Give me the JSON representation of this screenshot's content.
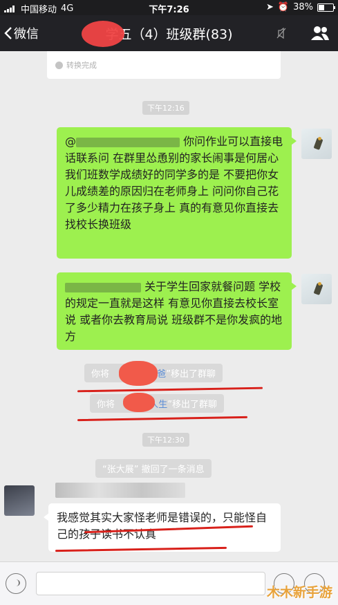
{
  "status_bar": {
    "carrier": "中国移动",
    "network": "4G",
    "time": "下午7:26",
    "battery": "38%",
    "battery_level": 0.38
  },
  "nav": {
    "back_label": "微信",
    "title": "学五（4）班级群(83)"
  },
  "file_card": {
    "status": "转换完成"
  },
  "messages": {
    "time1": "下午12:16",
    "msg1": {
      "mention": "@",
      "text": "你问作业可以直接电话联系问  在群里怂恿别的家长闹事是何居心  我们班数学成绩好的同学多的是  不要把你女儿成绩差的原因归在老师身上  问问你自己花了多少精力在孩子身上  真的有意见你直接去找校长换班级"
    },
    "msg2": {
      "text": "关于学生回家就餐问题  学校的规定一直就是这样  有意见你直接去校长室说  或者你去教育局说  班级群不是你发疯的地方"
    },
    "sys1": {
      "prefix": "你将",
      "name": "爸爸",
      "suffix": "”移出了群聊"
    },
    "sys2": {
      "prefix": "你将",
      "name": "人生",
      "suffix": "”移出了群聊"
    },
    "time2": "下午12:30",
    "recall": "“张大展” 撤回了一条消息",
    "msg3": {
      "text": "我感觉其实大家怪老师是错误的，只能怪自己的孩子读书不认真"
    }
  },
  "watermark": "木木新手游",
  "icons": [
    "signal-icon",
    "location-icon",
    "alarm-icon",
    "battery-icon",
    "back-chevron-icon",
    "mute-icon",
    "group-members-icon",
    "voice-icon",
    "emoji-icon",
    "plus-icon"
  ],
  "colors": {
    "bubble_green": "#9df04f",
    "highlight_red": "#d8201a",
    "nav_bg": "#222226"
  }
}
